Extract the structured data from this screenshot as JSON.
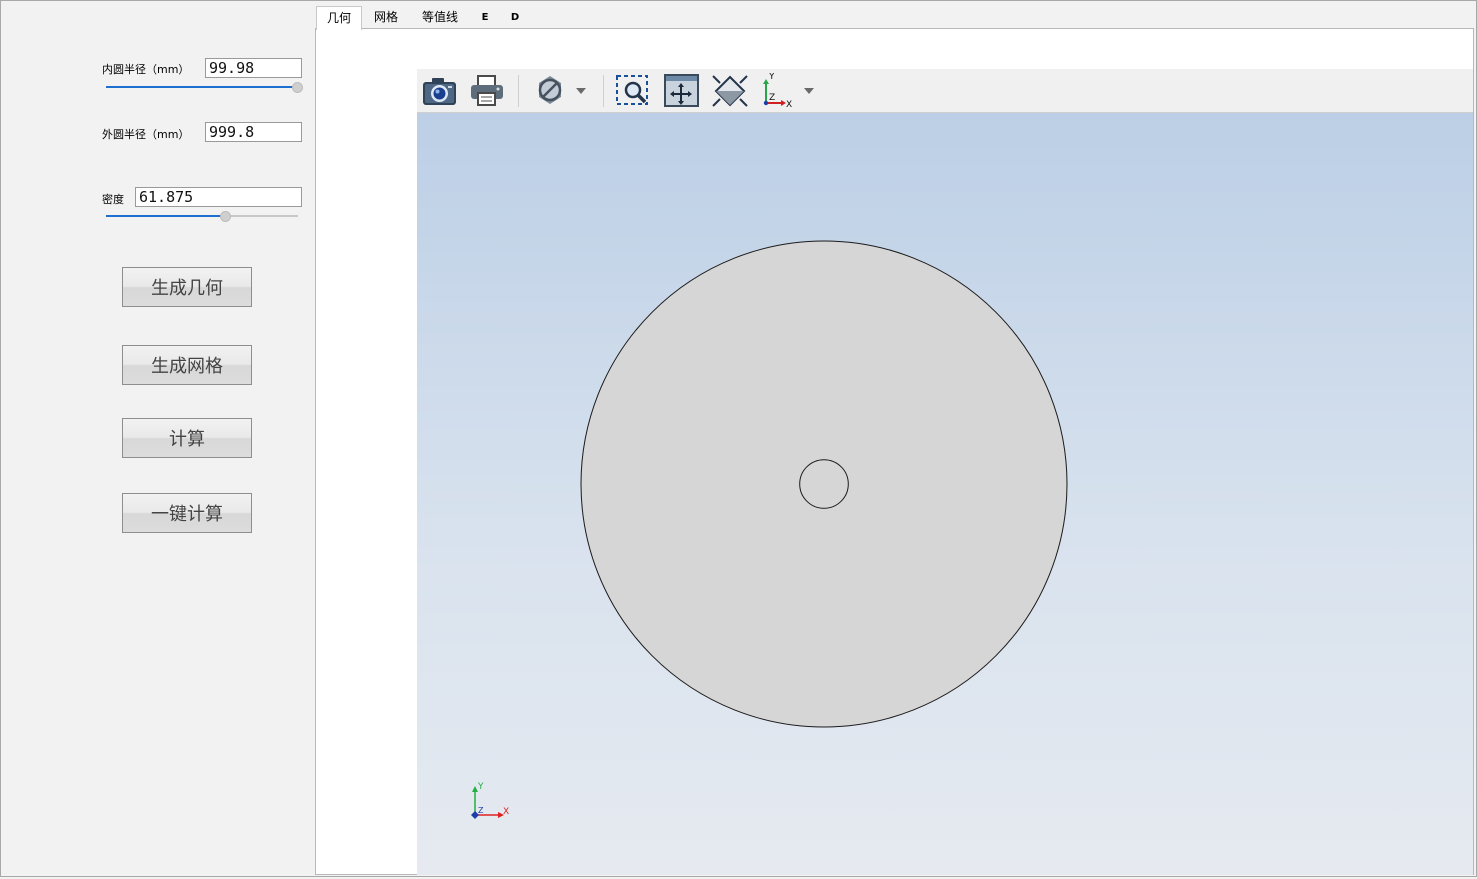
{
  "left_panel": {
    "inner_radius": {
      "label": "内圆半径（mm）",
      "value": "99.98",
      "slider_fraction": 0.98
    },
    "outer_radius": {
      "label": "外圆半径（mm）",
      "value": "999.8"
    },
    "density": {
      "label": "密度",
      "value": "61.875",
      "slider_fraction": 0.62
    },
    "buttons": {
      "generate_geometry": "生成几何",
      "generate_mesh": "生成网格",
      "compute": "计算",
      "one_click_compute": "一键计算"
    }
  },
  "tabs": [
    {
      "label": "几何",
      "active": true
    },
    {
      "label": "网格",
      "active": false
    },
    {
      "label": "等值线",
      "active": false
    },
    {
      "label": "E",
      "active": false
    },
    {
      "label": "D",
      "active": false
    }
  ],
  "toolbar": {
    "icons": [
      "camera-icon",
      "print-icon",
      "clipping-icon",
      "zoom-window-icon",
      "fit-all-icon",
      "view-iso-icon",
      "axis-view-icon"
    ],
    "axis_labels": {
      "x": "X",
      "y": "Y",
      "z": "Z"
    }
  },
  "viewport": {
    "shape": "annulus",
    "inner_radius_mm": 99.98,
    "outer_radius_mm": 999.8,
    "fill_color": "#d6d6d6",
    "edge_color": "#1a1a1a",
    "triad_labels": {
      "x": "X",
      "y": "Y",
      "z": "Z"
    }
  }
}
